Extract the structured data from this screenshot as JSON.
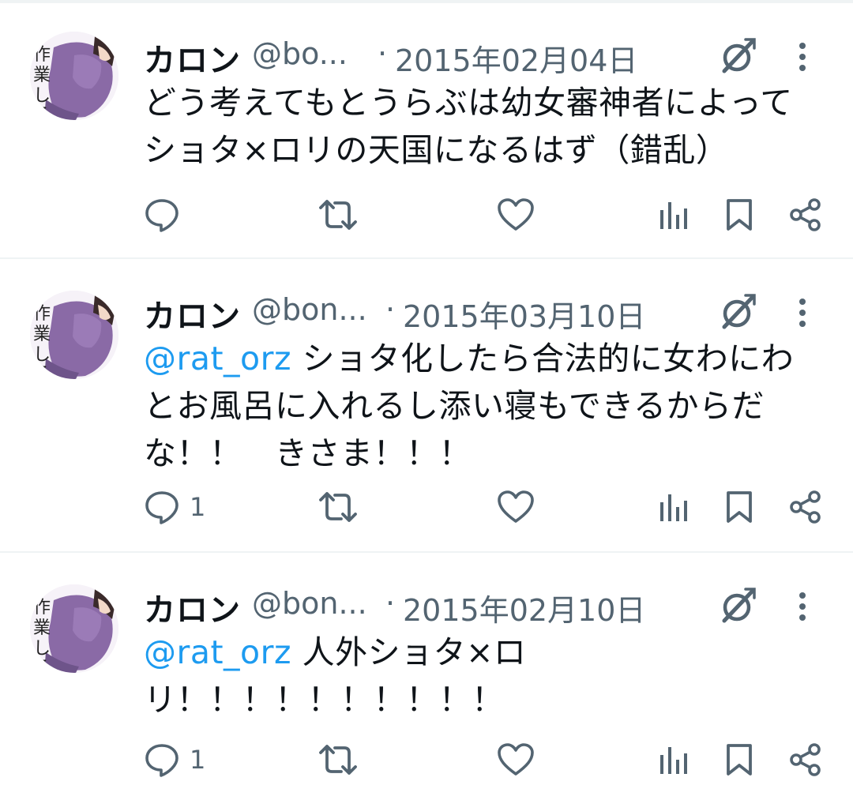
{
  "tweets": [
    {
      "name": "カロン",
      "handle": "@bo...",
      "separator": "·",
      "date": "2015年02月04日",
      "mention": "",
      "text_lines": [
        "どう考えてもとうらぶは幼女審神者によって",
        "ショタ×ロリの天国になるはず（錯乱）"
      ],
      "reply_count": "",
      "avatar_text": "作業しろ"
    },
    {
      "name": "カロン",
      "handle": "@bon...",
      "separator": "·",
      "date": "2015年03月10日",
      "mention": "@rat_orz",
      "text_first": " ショタ化したら合法的に女わにわ",
      "text_lines": [
        "とお風呂に入れるし添い寝もできるからだ",
        "な！！　きさま！！！"
      ],
      "reply_count": "1",
      "avatar_text": "作業しろ"
    },
    {
      "name": "カロン",
      "handle": "@bon...",
      "separator": "·",
      "date": "2015年02月10日",
      "mention": "@rat_orz",
      "text_first": " 人外ショタ×ロ",
      "text_lines": [
        "リ！！！！！！！！！！"
      ],
      "reply_count": "1",
      "avatar_text": "作業しろ"
    }
  ],
  "icons": {
    "reply": "reply-icon",
    "retweet": "retweet-icon",
    "like": "heart-icon",
    "views": "analytics-icon",
    "bookmark": "bookmark-icon",
    "share": "share-icon",
    "grok": "grok-icon",
    "more": "more-vertical-icon"
  },
  "colors": {
    "text": "#0f1419",
    "secondary": "#536471",
    "link": "#1d9bf0",
    "divider": "#eff3f4",
    "avatar_purple": "#8a6aa6"
  }
}
